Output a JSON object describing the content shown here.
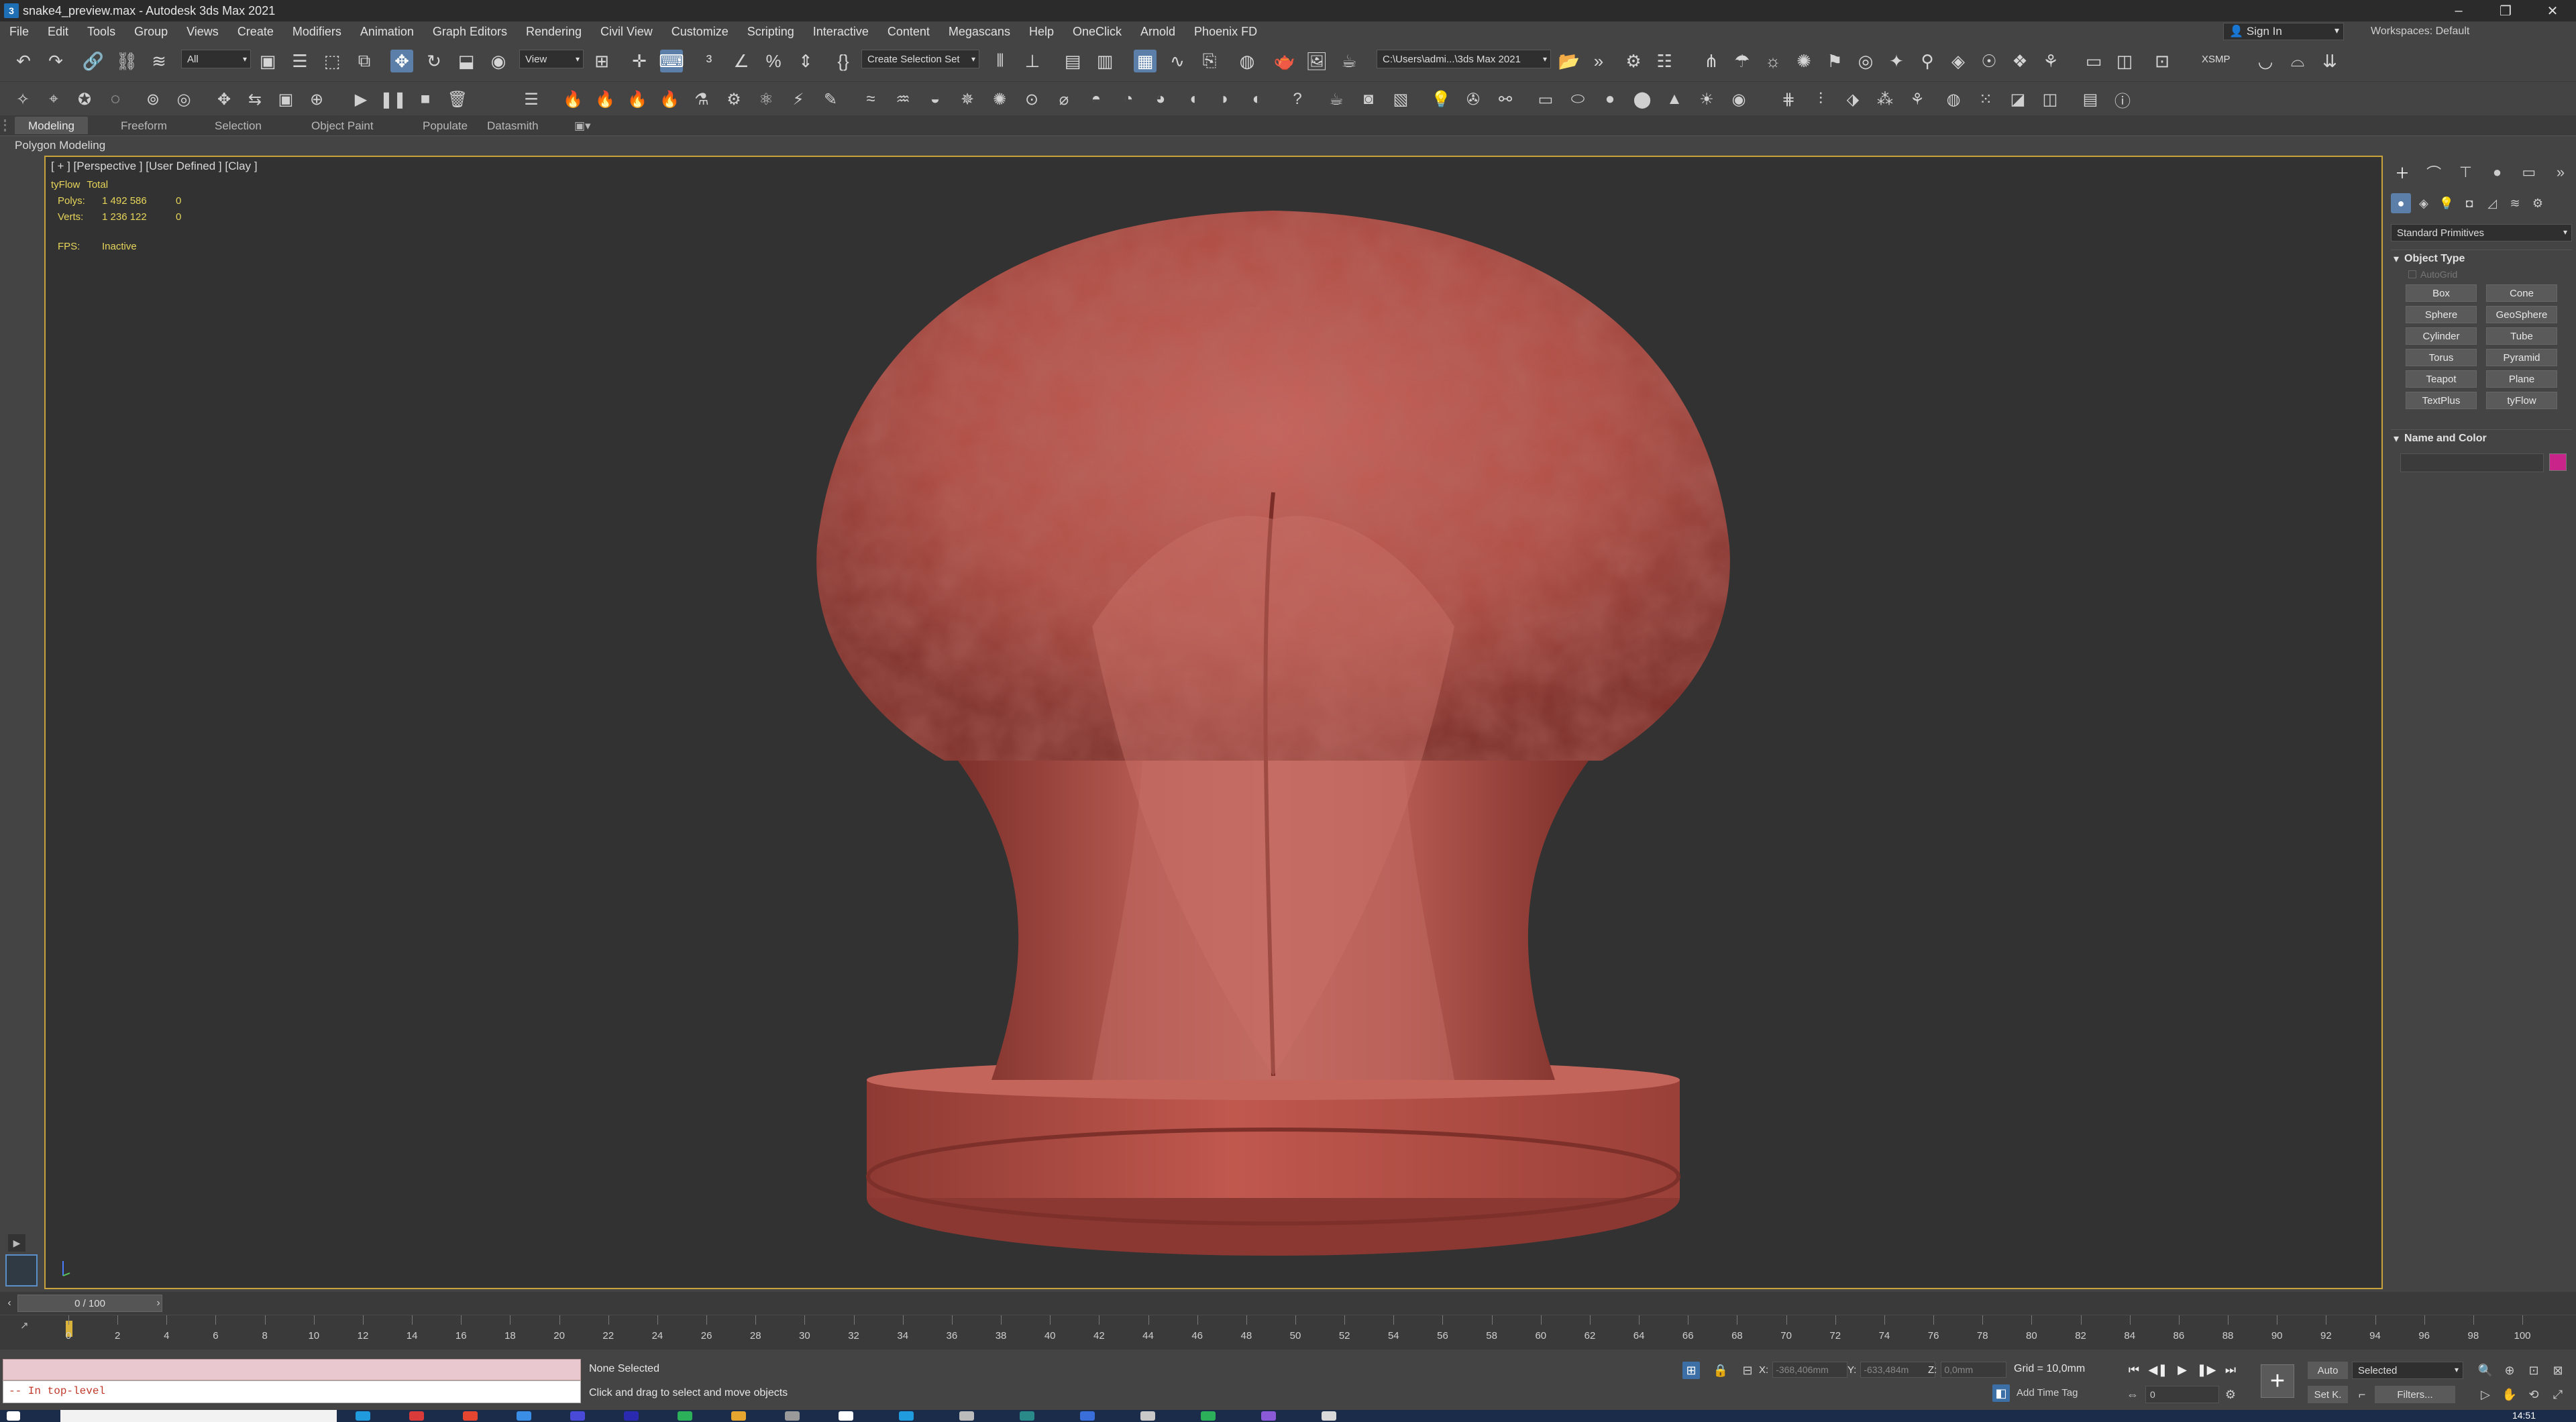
{
  "window": {
    "title": "snake4_preview.max - Autodesk 3ds Max 2021",
    "app_icon": "3"
  },
  "menu": {
    "items": [
      "File",
      "Edit",
      "Tools",
      "Group",
      "Views",
      "Create",
      "Modifiers",
      "Animation",
      "Graph Editors",
      "Rendering",
      "Civil View",
      "Customize",
      "Scripting",
      "Interactive",
      "Content",
      "Megascans",
      "Help",
      "OneClick",
      "Arnold",
      "Phoenix FD"
    ],
    "sign_in": "Sign In",
    "workspaces_label": "Workspaces: Default"
  },
  "toolbar": {
    "selection_filter": "All",
    "ref_coord": "View",
    "named_selection": "Create Selection Set",
    "project_path": "C:\\Users\\admi...\\3ds Max 2021",
    "xsmp_label": "XSMP"
  },
  "ribbon": {
    "tabs": [
      "Modeling",
      "Freeform",
      "Selection",
      "Object Paint",
      "Populate",
      "Datasmith"
    ],
    "active_tab": "Modeling",
    "panel_label": "Polygon Modeling"
  },
  "viewport": {
    "label": "[ + ] [Perspective ] [User Defined ] [Clay ]",
    "stats_header": [
      "tyFlow",
      "Total"
    ],
    "polys_label": "Polys:",
    "polys_total": "1 492 586",
    "polys_sel": "0",
    "verts_label": "Verts:",
    "verts_total": "1 236 122",
    "verts_sel": "0",
    "fps_label": "FPS:",
    "fps_value": "Inactive",
    "model_color": "#b5483f"
  },
  "command_panel": {
    "category": "Standard Primitives",
    "object_type_title": "Object Type",
    "autogrid": "AutoGrid",
    "buttons": [
      "Box",
      "Cone",
      "Sphere",
      "GeoSphere",
      "Cylinder",
      "Tube",
      "Torus",
      "Pyramid",
      "Teapot",
      "Plane",
      "TextPlus",
      "tyFlow"
    ],
    "name_color_title": "Name and Color",
    "object_color": "#c8248a"
  },
  "timeline": {
    "frame_counter": "0 / 100",
    "ticks": [
      0,
      2,
      4,
      6,
      8,
      10,
      12,
      14,
      16,
      18,
      20,
      22,
      24,
      26,
      28,
      30,
      32,
      34,
      36,
      38,
      40,
      42,
      44,
      46,
      48,
      50,
      52,
      54,
      56,
      58,
      60,
      62,
      64,
      66,
      68,
      70,
      72,
      74,
      76,
      78,
      80,
      82,
      84,
      86,
      88,
      90,
      92,
      94,
      96,
      98,
      100
    ]
  },
  "status": {
    "listener_output": "-- In top-level",
    "selection": "None Selected",
    "prompt": "Click and drag to select and move objects",
    "x_label": "X:",
    "x_value": "-368,406mm",
    "y_label": "Y:",
    "y_value": "-633,484m",
    "z_label": "Z:",
    "z_value": "0,0mm",
    "grid": "Grid = 10,0mm",
    "add_time_tag": "Add Time Tag",
    "current_frame": "0",
    "auto_key": "Auto",
    "set_key": "Set K.",
    "key_filter_select": "Selected",
    "filters": "Filters...",
    "clock": "14:51"
  }
}
